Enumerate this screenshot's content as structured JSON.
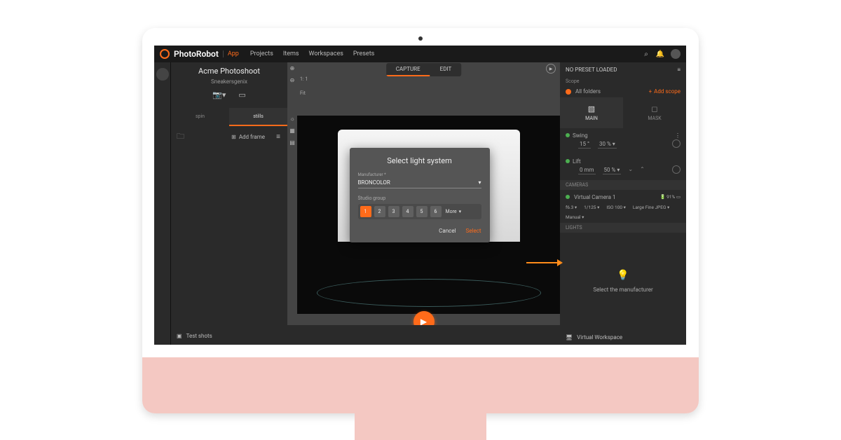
{
  "brand": "PhotoRobot",
  "app_badge": "App",
  "nav": [
    "Projects",
    "Items",
    "Workspaces",
    "Presets"
  ],
  "left": {
    "title": "Acme Photoshoot",
    "subtitle": "Sneakersgenix",
    "tabs": [
      "spin",
      "stills"
    ],
    "add_frame": "Add frame",
    "test_shots": "Test shots"
  },
  "center": {
    "mode_tabs": [
      "CAPTURE",
      "EDIT"
    ],
    "status": "1: 1",
    "fit": "Fit"
  },
  "right": {
    "preset": "NO PRESET LOADED",
    "scope_label": "Scope",
    "all_folders": "All folders",
    "add_scope": "Add scope",
    "tabs": {
      "main": "MAIN",
      "mask": "MASK"
    },
    "swing": {
      "label": "Swing",
      "deg": "15 °",
      "pct": "30 % ▾"
    },
    "lift": {
      "label": "Lift",
      "mm": "0 mm",
      "pct": "50 % ▾"
    },
    "cameras_header": "CAMERAS",
    "camera": {
      "name": "Virtual Camera 1",
      "aperture": "f6.3 ▾",
      "shutter": "1/125 ▾",
      "iso": "ISO 100 ▾",
      "format": "Large Fine JPEG ▾",
      "mode": "Manual ▾",
      "battery": "91%"
    },
    "lights_header": "LIGHTS",
    "lights_hint": "Select the manufacturer",
    "virtual_workspace": "Virtual Workspace"
  },
  "dialog": {
    "title": "Select light system",
    "manufacturer_label": "Manufacturer *",
    "manufacturer_value": "BRONCOLOR",
    "group_label": "Studio group",
    "groups": [
      "1",
      "2",
      "3",
      "4",
      "5",
      "6"
    ],
    "more": "More",
    "cancel": "Cancel",
    "select": "Select"
  }
}
